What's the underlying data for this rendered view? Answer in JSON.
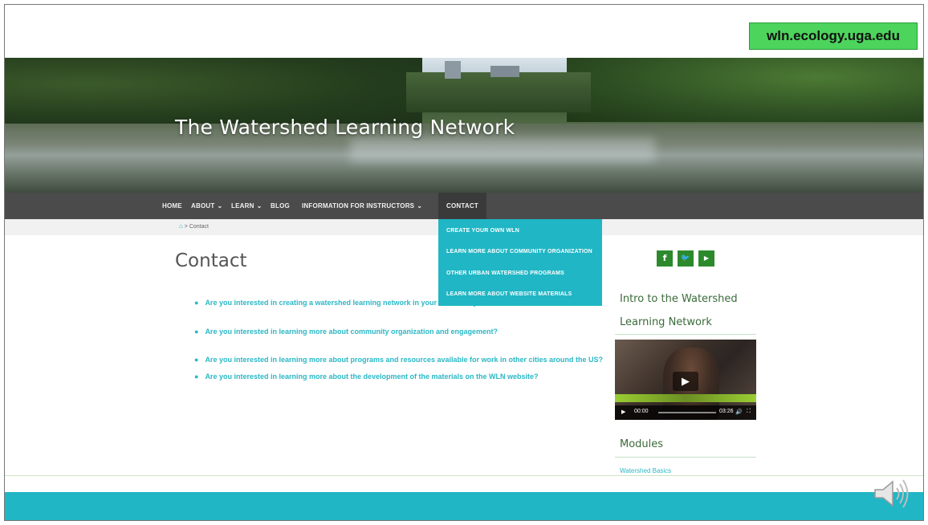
{
  "url_badge": "wln.ecology.uga.edu",
  "site_title": "The Watershed Learning Network",
  "nav": {
    "home": "HOME",
    "about": "ABOUT",
    "learn": "LEARN",
    "blog": "BLOG",
    "instructors": "INFORMATION FOR INSTRUCTORS",
    "contact": "CONTACT",
    "caret_glyph": "⌄"
  },
  "breadcrumb": {
    "home_icon": "home-icon",
    "separator": ">",
    "current": "Contact"
  },
  "contact_dropdown": [
    "CREATE YOUR OWN WLN",
    "LEARN MORE ABOUT COMMUNITY ORGANIZATION",
    "OTHER URBAN WATERSHED PROGRAMS",
    "LEARN MORE ABOUT WEBSITE MATERIALS"
  ],
  "main": {
    "title": "Contact",
    "links": [
      "Are you interested in creating a watershed learning network in your community?",
      "Are you interested in learning more about community organization and engagement?",
      "Are you interested in learning more about programs and resources available for work in other cities around the US?",
      "Are you interested in learning more about the development of the materials on the WLN website?"
    ]
  },
  "sidebar": {
    "social": [
      {
        "icon": "facebook-icon",
        "glyph": "f"
      },
      {
        "icon": "twitter-icon",
        "glyph": "🐦"
      },
      {
        "icon": "youtube-icon",
        "glyph": "▶"
      }
    ],
    "video_heading_line1": "Intro to the Watershed",
    "video_heading_line2": "Learning Network",
    "video": {
      "current_time": "00:00",
      "duration": "03:26",
      "progress": 0
    },
    "modules_heading": "Modules",
    "modules_first_link": "Watershed Basics"
  },
  "colors": {
    "accent_teal": "#20b6c5",
    "nav_bg": "#4b4b4b",
    "badge_green": "#4cd45c",
    "social_green": "#2c8a2c"
  }
}
